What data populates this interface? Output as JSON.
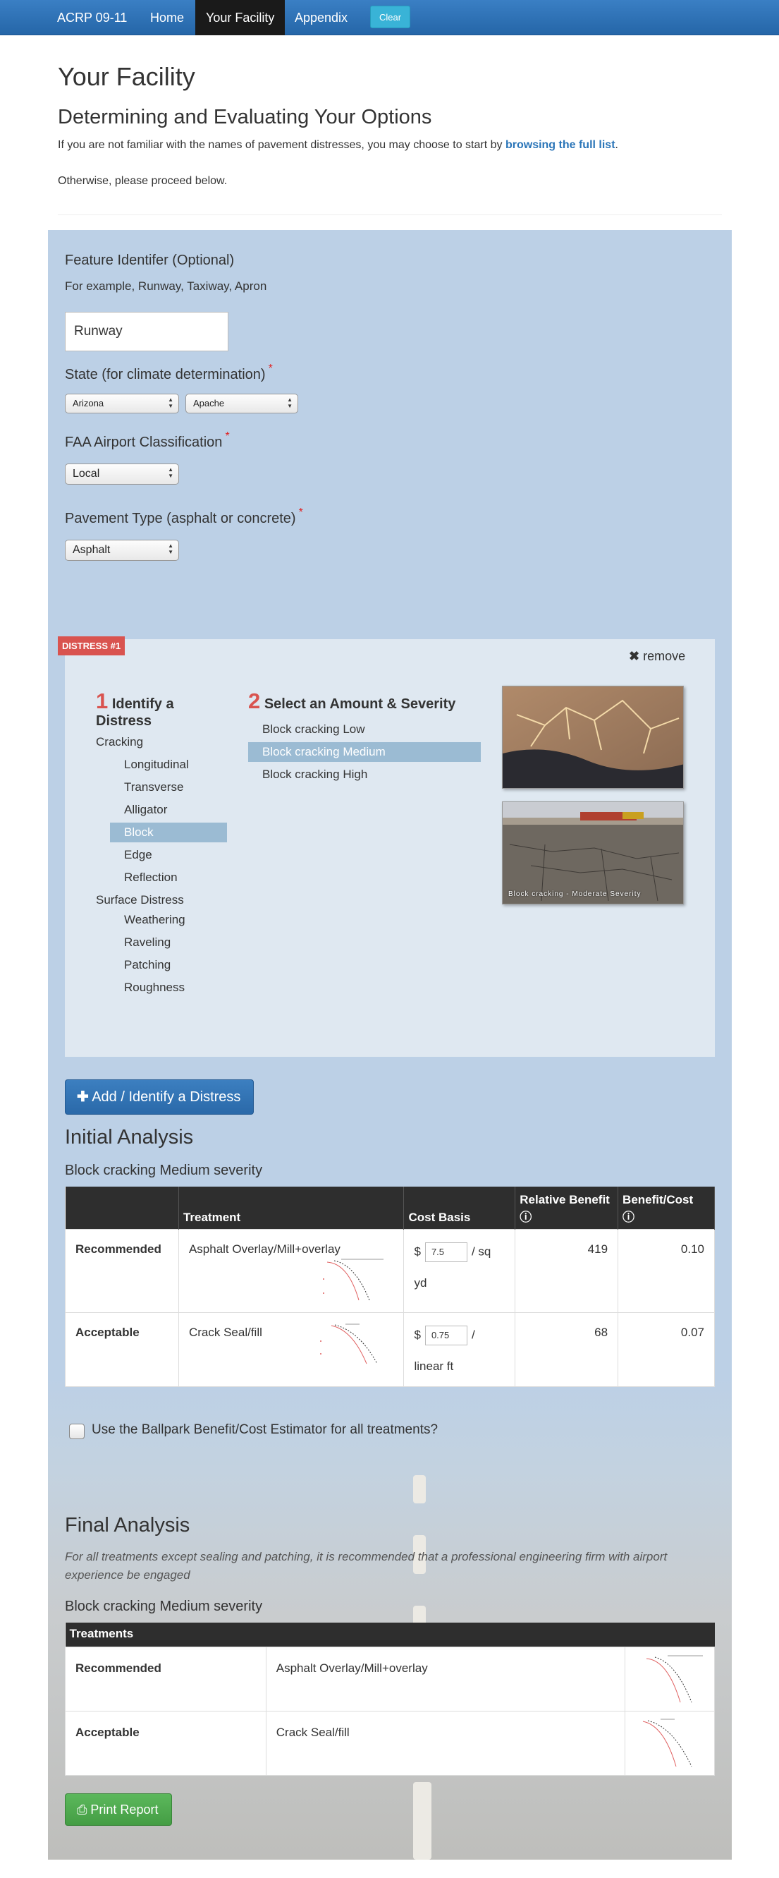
{
  "nav": {
    "brand": "ACRP 09-11",
    "home": "Home",
    "facility": "Your Facility",
    "appendix": "Appendix",
    "clear": "Clear"
  },
  "page": {
    "title": "Your Facility",
    "subtitle": "Determining and Evaluating Your Options",
    "intro_prefix": "If you are not familiar with the names of pavement distresses, you may choose to start by ",
    "intro_link": "browsing the full list",
    "intro_suffix": ".",
    "proceed": "Otherwise, please proceed below."
  },
  "form": {
    "feature_label": "Feature Identifer (Optional)",
    "feature_hint": "For example, Runway, Taxiway, Apron",
    "feature_value": "Runway",
    "state_label": "State (for climate determination)",
    "state_value": "Arizona",
    "county_value": "Apache",
    "faa_label": "FAA Airport Classification",
    "faa_value": "Local",
    "pavement_label": "Pavement Type (asphalt or concrete)",
    "pavement_value": "Asphalt",
    "required_mark": "*"
  },
  "distress": {
    "badge": "DISTRESS #1",
    "remove": "remove",
    "step1_num": "1",
    "step1_label": "Identify a Distress",
    "step2_num": "2",
    "step2_label": "Select an Amount & Severity",
    "categories": [
      {
        "label": "Cracking",
        "items": [
          "Longitudinal",
          "Transverse",
          "Alligator",
          "Block",
          "Edge",
          "Reflection"
        ]
      },
      {
        "label": "Surface Distress",
        "items": [
          "Weathering",
          "Raveling",
          "Patching",
          "Roughness"
        ]
      }
    ],
    "selected_item": "Block",
    "severities": [
      "Block cracking Low",
      "Block cracking Medium",
      "Block cracking High"
    ],
    "selected_severity": "Block cracking Medium",
    "photo_caption": "Block cracking - Moderate Severity"
  },
  "add_button": "Add / Identify a Distress",
  "initial": {
    "title": "Initial Analysis",
    "subtitle": "Block cracking Medium severity",
    "headers": [
      "",
      "Treatment",
      "Cost Basis",
      "Relative Benefit",
      "Benefit/Cost"
    ],
    "rows": [
      {
        "level": "Recommended",
        "treatment": "Asphalt Overlay/Mill+overlay",
        "currency": "$",
        "cost": "7.5",
        "unit_a": "/ sq",
        "unit_b": "yd",
        "benefit": "419",
        "ratio": "0.10"
      },
      {
        "level": "Acceptable",
        "treatment": "Crack Seal/fill",
        "currency": "$",
        "cost": "0.75",
        "unit_a": "/",
        "unit_b": "linear ft",
        "benefit": "68",
        "ratio": "0.07"
      }
    ]
  },
  "ballpark_label": "Use the Ballpark Benefit/Cost Estimator for all treatments?",
  "final": {
    "title": "Final Analysis",
    "note": "For all treatments except sealing and patching, it is recommended that a professional engineering firm with airport experience be engaged",
    "subtitle": "Block cracking Medium severity",
    "header": "Treatments",
    "rows": [
      {
        "level": "Recommended",
        "treatment": "Asphalt Overlay/Mill+overlay"
      },
      {
        "level": "Acceptable",
        "treatment": "Crack Seal/fill"
      }
    ]
  },
  "print_button": "Print Report",
  "colors": {
    "nav": "#2566a8",
    "panel": "#bcd0e6",
    "accent_red": "#d9534f",
    "link": "#2a75b8",
    "selected": "#9bbbd3",
    "success": "#5cb85c"
  }
}
